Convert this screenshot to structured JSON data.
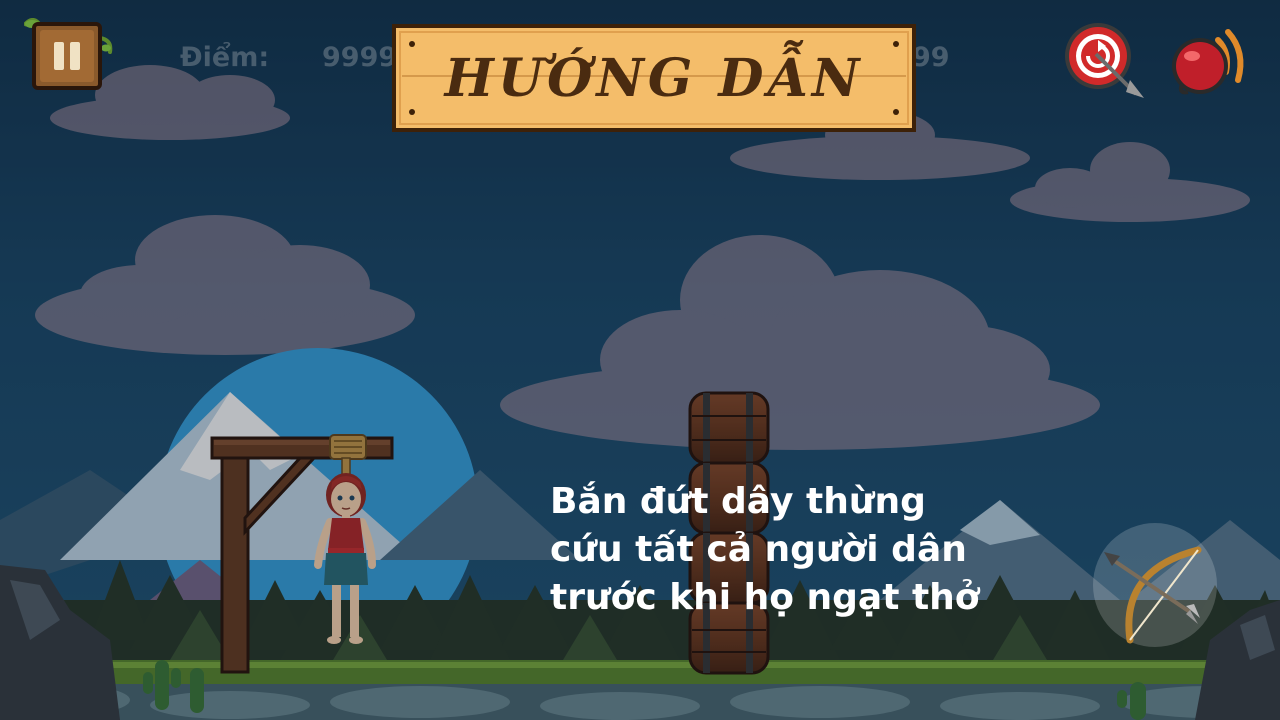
{
  "hud": {
    "score_label": "Điểm:",
    "score_value": "9999",
    "score_value_tail": "99",
    "pause_icon": "pause-icon",
    "restart_icon": "restart-target-icon",
    "sound_icon": "sound-icon"
  },
  "title_sign": {
    "text": "HƯỚNG DẪN"
  },
  "instruction": {
    "lines": [
      "Bắn đứt dây thừng",
      "cứu tất cả người dân",
      "trước khi họ ngạt thở"
    ]
  },
  "controls": {
    "bow_icon": "bow-arrow-icon"
  },
  "colors": {
    "sky": "#1d4a6a",
    "sign_wood": "#f4bd6a",
    "sign_text": "#4a2b10",
    "instruction_text": "#ffffff",
    "hud_text": "#5b6d7c"
  }
}
